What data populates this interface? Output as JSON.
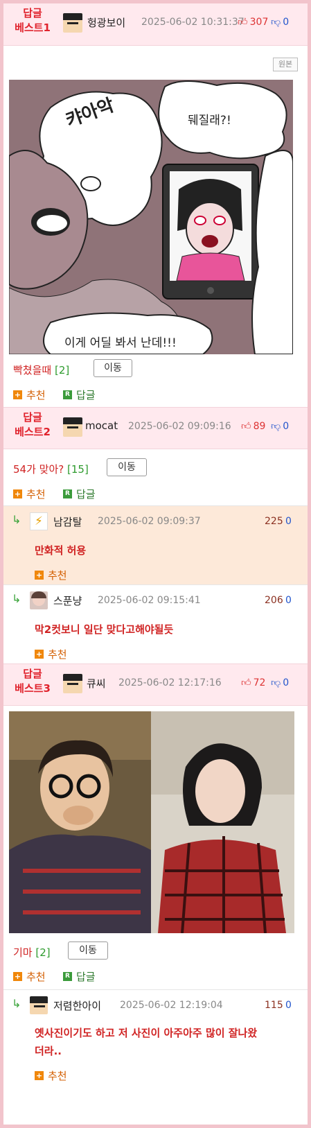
{
  "best1": {
    "label_line1": "답글",
    "label_line2": "베스트1",
    "nick": "헝광보이",
    "date": "2025-06-02 10:31:37",
    "likes": "307",
    "dislikes": "0",
    "original_btn": "원본",
    "comic_caption_top": "캬아악",
    "comic_bubble": "뒈질래?!",
    "comic_caption_bottom": "이게 어딜 봐서 난데!!!",
    "reply_title": "빡쳤을때",
    "reply_count": "[2]",
    "move_btn": "이동",
    "recommend": "추천",
    "reply": "답글"
  },
  "best2": {
    "label_line1": "답글",
    "label_line2": "베스트2",
    "nick": "mocat",
    "date": "2025-06-02 09:09:16",
    "likes": "89",
    "dislikes": "0",
    "reply_title": "54가 맞아?",
    "reply_count": "[15]",
    "move_btn": "이동",
    "recommend": "추천",
    "reply": "답글",
    "comments": [
      {
        "nick": "남감탈",
        "date": "2025-06-02 09:09:37",
        "likes": "225",
        "dislikes": "0",
        "text": "만화적 허용",
        "recommend": "추천"
      },
      {
        "nick": "스푼냥",
        "date": "2025-06-02 09:15:41",
        "likes": "206",
        "dislikes": "0",
        "text": "막2컷보니 일단 맞다고해야될듯",
        "recommend": "추천"
      }
    ]
  },
  "best3": {
    "label_line1": "답글",
    "label_line2": "베스트3",
    "nick": "큐씨",
    "date": "2025-06-02 12:17:16",
    "likes": "72",
    "dislikes": "0",
    "reply_title": "기마",
    "reply_count": "[2]",
    "move_btn": "이동",
    "recommend": "추천",
    "reply": "답글",
    "comments": [
      {
        "nick": "저렴한아이",
        "date": "2025-06-02 12:19:04",
        "likes": "115",
        "dislikes": "0",
        "text_line1": "옛사진이기도 하고 저 사진이 아주아주 많이 잘나왔",
        "text_line2": "더라..",
        "recommend": "추천"
      }
    ]
  },
  "colors": {
    "accent_red": "#d02323",
    "header_bg": "#ffe9ee",
    "border_pink": "#f2c4cc",
    "highlight_comment": "#fde9d9",
    "like_red": "#d33333",
    "dislike_blue": "#2255cc"
  },
  "icons": [
    "thumbs-up-icon",
    "thumbs-down-icon",
    "plus-icon",
    "reply-r-icon",
    "reply-arrow-icon",
    "lightning-avatar-icon"
  ]
}
